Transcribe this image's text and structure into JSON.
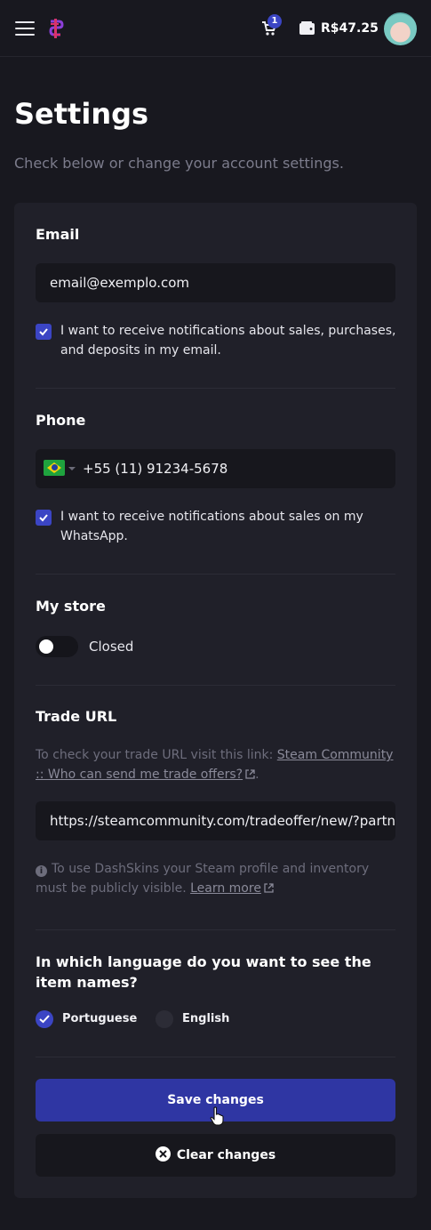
{
  "header": {
    "cart_count": "1",
    "balance": "R$47.25",
    "icons": [
      "menu-icon",
      "logo-icon",
      "cart-icon",
      "wallet-icon",
      "avatar"
    ]
  },
  "page": {
    "title": "Settings",
    "subtitle": "Check below or change your account settings."
  },
  "email": {
    "title": "Email",
    "value": "email@exemplo.com",
    "notify_checked": true,
    "notify_label": "I want to receive notifications about sales, purchases, and deposits in my email."
  },
  "phone": {
    "title": "Phone",
    "country": "Brazil",
    "value": "+55 (11) 91234-5678",
    "notify_checked": true,
    "notify_label": "I want to receive notifications about sales on my WhatsApp."
  },
  "store": {
    "title": "My store",
    "enabled": false,
    "status_label": "Closed"
  },
  "trade_url": {
    "title": "Trade URL",
    "help_prefix": "To check your trade URL visit this link: ",
    "help_link": "Steam Community :: Who can send me trade offers?",
    "help_suffix": ".",
    "value": "https://steamcommunity.com/tradeoffer/new/?partner",
    "info_text": "To use DashSkins your Steam profile and inventory must be publicly visible. ",
    "info_link": "Learn more"
  },
  "language": {
    "title": "In which language do you want to see the item names?",
    "options": [
      {
        "label": "Portuguese",
        "selected": true
      },
      {
        "label": "English",
        "selected": false
      }
    ]
  },
  "actions": {
    "save_label": "Save changes",
    "clear_label": "Clear changes"
  },
  "colors": {
    "background": "#18181f",
    "card": "#202029",
    "accent": "#3b45c4",
    "primary_button": "#2f36a3",
    "muted_text": "#7c7c8c"
  }
}
